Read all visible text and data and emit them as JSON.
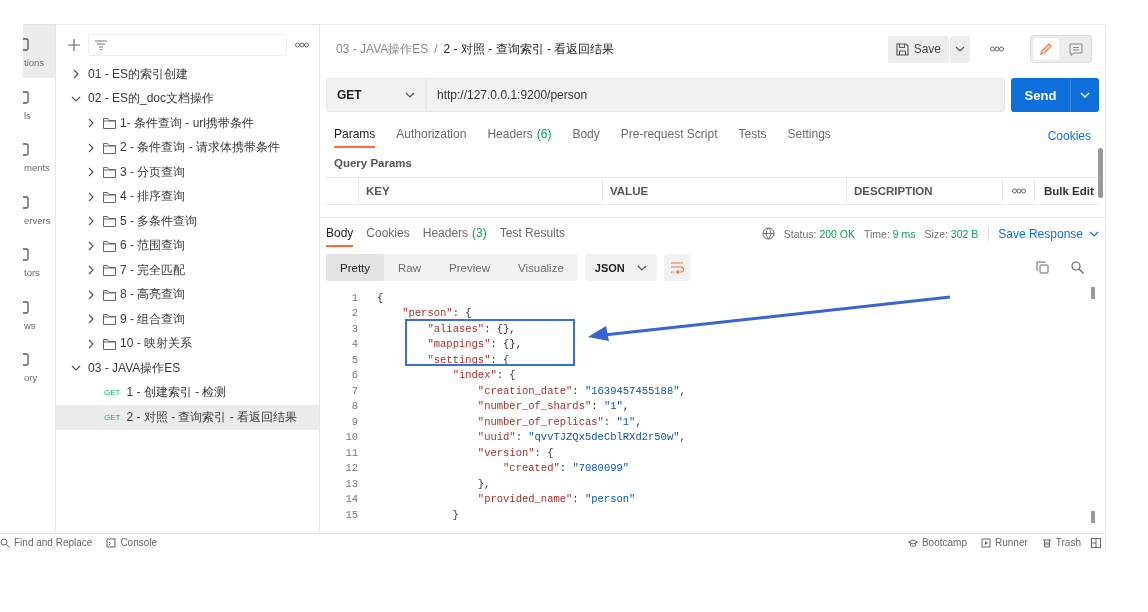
{
  "nav_rail": [
    {
      "label": "tions",
      "selected": true
    },
    {
      "label": "ls",
      "selected": false
    },
    {
      "label": "ments",
      "selected": false
    },
    {
      "label": "ervers",
      "selected": false
    },
    {
      "label": "tors",
      "selected": false
    },
    {
      "label": "ws",
      "selected": false
    },
    {
      "label": "ory",
      "selected": false
    }
  ],
  "sidebar": {
    "tree": [
      {
        "kind": "collection",
        "label": "01 - ES的索引创建",
        "expanded": false
      },
      {
        "kind": "collection",
        "label": "02 - ES的_doc文档操作",
        "expanded": true,
        "children": [
          {
            "kind": "folder",
            "label": "1- 条件查询 - url携带条件",
            "expanded": false
          },
          {
            "kind": "folder",
            "label": "2 - 条件查询 - 请求体携带条件",
            "expanded": false
          },
          {
            "kind": "folder",
            "label": "3 - 分页查询",
            "expanded": false
          },
          {
            "kind": "folder",
            "label": "4 - 排序查询",
            "expanded": false
          },
          {
            "kind": "folder",
            "label": "5 - 多条件查询",
            "expanded": false
          },
          {
            "kind": "folder",
            "label": "6 - 范围查询",
            "expanded": false
          },
          {
            "kind": "folder",
            "label": "7 - 完全匹配",
            "expanded": false
          },
          {
            "kind": "folder",
            "label": "8 - 高亮查询",
            "expanded": false
          },
          {
            "kind": "folder",
            "label": "9 - 组合查询",
            "expanded": false
          },
          {
            "kind": "folder",
            "label": "10 - 映射关系",
            "expanded": false
          }
        ]
      },
      {
        "kind": "collection",
        "label": "03 - JAVA操作ES",
        "expanded": true,
        "children": [
          {
            "kind": "request",
            "method": "GET",
            "label": "1 - 创建索引 - 检测",
            "selected": false
          },
          {
            "kind": "request",
            "method": "GET",
            "label": "2 - 对照 - 查询索引 - 看返回结果",
            "selected": true
          }
        ]
      }
    ]
  },
  "breadcrumb": {
    "parent": "03 - JAVA操作ES",
    "separator": "/",
    "current": "2 - 对照 - 查询索引 - 看返回结果"
  },
  "toolbar": {
    "save": "Save"
  },
  "request": {
    "method": "GET",
    "url": "http://127.0.0.1:9200/person",
    "send": "Send"
  },
  "request_tabs": [
    {
      "label": "Params",
      "selected": true
    },
    {
      "label": "Authorization",
      "selected": false
    },
    {
      "label": "Headers",
      "count": "(6)",
      "selected": false
    },
    {
      "label": "Body",
      "selected": false
    },
    {
      "label": "Pre-request Script",
      "selected": false
    },
    {
      "label": "Tests",
      "selected": false
    },
    {
      "label": "Settings",
      "selected": false
    }
  ],
  "cookies_link": "Cookies",
  "query_params": {
    "title": "Query Params",
    "columns": [
      "KEY",
      "VALUE",
      "DESCRIPTION"
    ],
    "bulk_edit": "Bulk Edit"
  },
  "response_tabs": [
    {
      "label": "Body",
      "selected": true
    },
    {
      "label": "Cookies",
      "selected": false
    },
    {
      "label": "Headers",
      "count": "(3)",
      "selected": false
    },
    {
      "label": "Test Results",
      "selected": false
    }
  ],
  "response_status": {
    "status_label": "Status:",
    "status": "200 OK",
    "time_label": "Time:",
    "time": "9 ms",
    "size_label": "Size:",
    "size": "302 B"
  },
  "save_response": "Save Response",
  "view_modes": [
    {
      "label": "Pretty",
      "selected": true
    },
    {
      "label": "Raw",
      "selected": false
    },
    {
      "label": "Preview",
      "selected": false
    },
    {
      "label": "Visualize",
      "selected": false
    }
  ],
  "format": "JSON",
  "code_lines": [
    {
      "number": "1",
      "text": "{"
    },
    {
      "number": "2",
      "text": "    \"person\": {"
    },
    {
      "number": "3",
      "text": "        \"aliases\": {},"
    },
    {
      "number": "4",
      "text": "        \"mappings\": {},"
    },
    {
      "number": "5",
      "text": "        \"settings\": {"
    },
    {
      "number": "6",
      "text": "            \"index\": {"
    },
    {
      "number": "7",
      "text": "                \"creation_date\": \"1639457455188\","
    },
    {
      "number": "8",
      "text": "                \"number_of_shards\": \"1\","
    },
    {
      "number": "9",
      "text": "                \"number_of_replicas\": \"1\","
    },
    {
      "number": "10",
      "text": "                \"uuid\": \"qvvTJZQx5deCblRXd2r50w\","
    },
    {
      "number": "11",
      "text": "                \"version\": {"
    },
    {
      "number": "12",
      "text": "                    \"created\": \"7080099\""
    },
    {
      "number": "13",
      "text": "                },"
    },
    {
      "number": "14",
      "text": "                \"provided_name\": \"person\""
    },
    {
      "number": "15",
      "text": "            }"
    }
  ],
  "status_bar": {
    "left": [
      "Find and Replace",
      "Console"
    ],
    "right": [
      "Bootcamp",
      "Runner",
      "Trash"
    ]
  }
}
